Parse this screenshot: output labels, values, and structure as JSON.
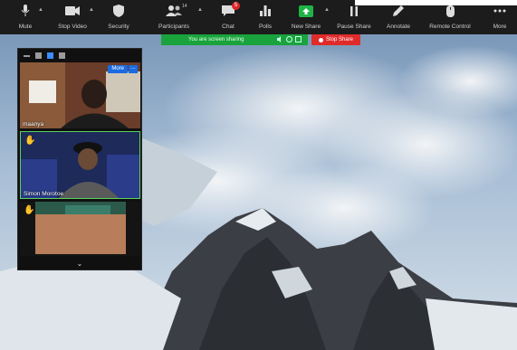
{
  "toolbar": {
    "mute_label": "Mute",
    "stop_video_label": "Stop Video",
    "security_label": "Security",
    "participants_label": "Participants",
    "participants_count": "14",
    "chat_label": "Chat",
    "chat_badge": "5",
    "polls_label": "Polls",
    "new_share_label": "New Share",
    "pause_share_label": "Pause Share",
    "annotate_label": "Annotate",
    "remote_control_label": "Remote Control",
    "more_label": "More"
  },
  "share_bar": {
    "status_text": "You are screen sharing",
    "stop_label": "Stop Share",
    "colors": {
      "green": "#1aa33d",
      "red": "#e02b2b"
    }
  },
  "gallery": {
    "tiles": [
      {
        "name": "maanya",
        "more_label": "More"
      },
      {
        "name": "Simon Morotoe"
      },
      {
        "name": ""
      }
    ]
  }
}
